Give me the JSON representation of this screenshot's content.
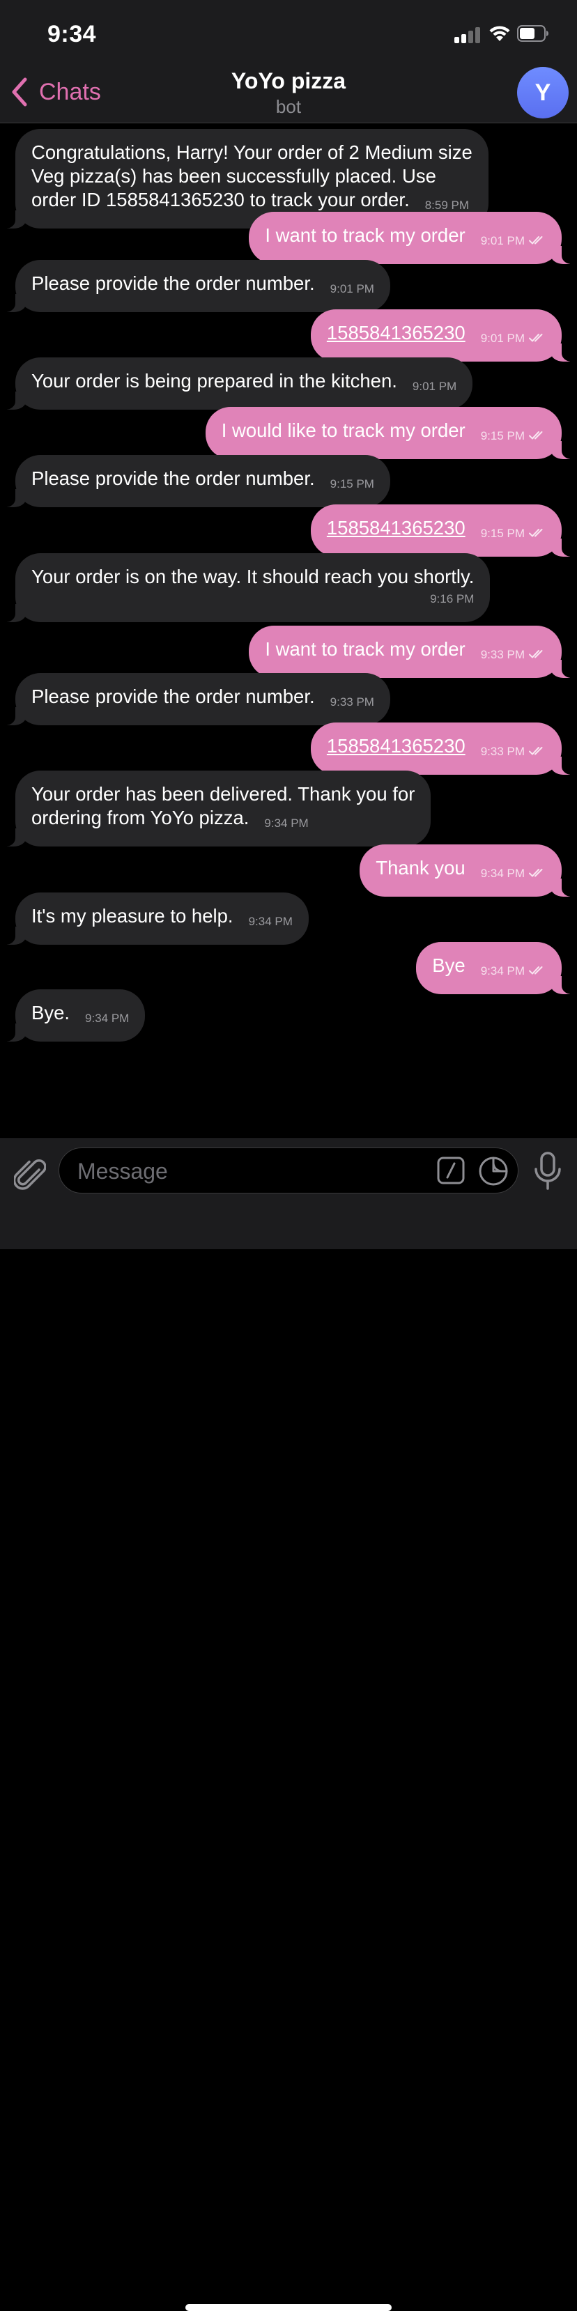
{
  "status_bar": {
    "time": "9:34"
  },
  "header": {
    "back_label": "Chats",
    "title": "YoYo pizza",
    "subtitle": "bot",
    "avatar_letter": "Y"
  },
  "messages": [
    {
      "dir": "in",
      "text": "Congratulations, Harry! Your order of 2 Medium size\nVeg pizza(s) has been successfully placed. Use\norder ID 1585841365230 to track your order.",
      "time": "8:59 PM"
    },
    {
      "dir": "out",
      "text": "I want to track my order",
      "time": "9:01 PM"
    },
    {
      "dir": "in",
      "text": "Please provide the order number.",
      "time": "9:01 PM"
    },
    {
      "dir": "out",
      "text": "1585841365230",
      "time": "9:01 PM",
      "link": true
    },
    {
      "dir": "in",
      "text": "Your order is being prepared in the kitchen.",
      "time": "9:01 PM"
    },
    {
      "dir": "out",
      "text": "I would like to track my order",
      "time": "9:15 PM"
    },
    {
      "dir": "in",
      "text": "Please provide the order number.",
      "time": "9:15 PM"
    },
    {
      "dir": "out",
      "text": "1585841365230",
      "time": "9:15 PM",
      "link": true
    },
    {
      "dir": "in",
      "text": "Your order is on the way. It should reach you shortly.",
      "time": "9:16 PM",
      "time_below": true
    },
    {
      "dir": "out",
      "text": "I want to track my order",
      "time": "9:33 PM"
    },
    {
      "dir": "in",
      "text": "Please provide the order number.",
      "time": "9:33 PM"
    },
    {
      "dir": "out",
      "text": "1585841365230",
      "time": "9:33 PM",
      "link": true
    },
    {
      "dir": "in",
      "text": "Your order has been delivered. Thank you for\nordering from YoYo pizza.",
      "time": "9:34 PM"
    },
    {
      "dir": "out",
      "text": "Thank you",
      "time": "9:34 PM"
    },
    {
      "dir": "in",
      "text": "It's my pleasure to help.",
      "time": "9:34 PM"
    },
    {
      "dir": "out",
      "text": "Bye",
      "time": "9:34 PM"
    },
    {
      "dir": "in",
      "text": "Bye.",
      "time": "9:34 PM"
    }
  ],
  "composer": {
    "placeholder": "Message"
  },
  "colors": {
    "accent": "#e070b0",
    "outgoing_bubble": "#e083b8",
    "incoming_bubble": "#262628",
    "avatar": "#6a80f8"
  },
  "icons": [
    "back-chevron-icon",
    "signal-icon",
    "wifi-icon",
    "battery-icon",
    "paperclip-icon",
    "bot-command-icon",
    "sticker-icon",
    "microphone-icon",
    "double-check-icon"
  ]
}
